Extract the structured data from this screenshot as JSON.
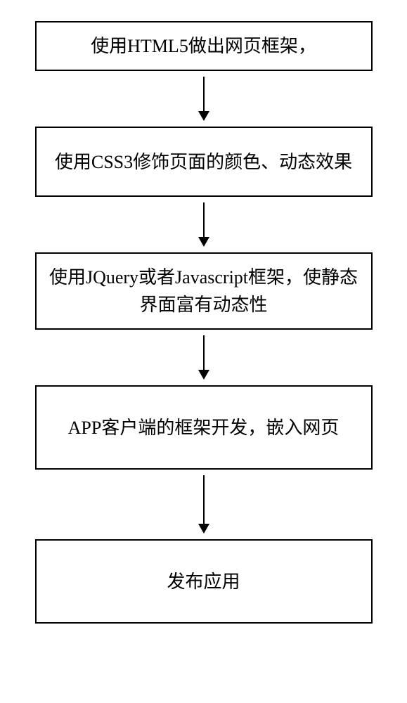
{
  "flowchart": {
    "steps": [
      {
        "text": "使用HTML5做出网页框架，",
        "size": "normal"
      },
      {
        "text": "使用CSS3修饰页面的颜色、动态效果",
        "size": "tall"
      },
      {
        "text": "使用JQuery或者Javascript框架，使静态界面富有动态性",
        "size": "tall"
      },
      {
        "text": "APP客户端的框架开发，嵌入网页",
        "size": "taller"
      },
      {
        "text": "发布应用",
        "size": "taller"
      }
    ],
    "arrows": [
      {
        "length": "normal"
      },
      {
        "length": "normal"
      },
      {
        "length": "normal"
      },
      {
        "length": "long"
      }
    ]
  }
}
